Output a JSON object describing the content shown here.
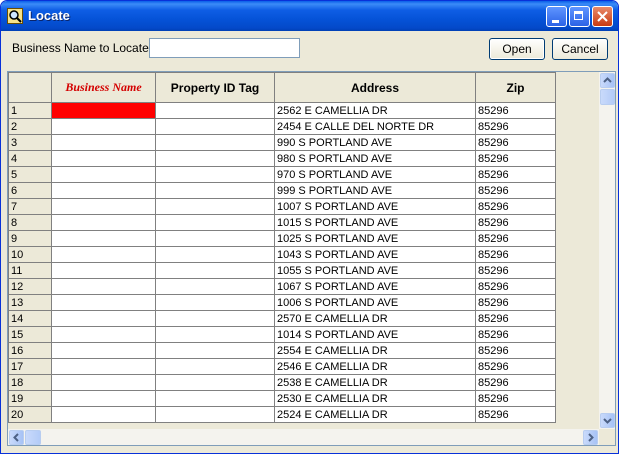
{
  "window": {
    "title": "Locate"
  },
  "form": {
    "label": "Business Name to Locate:",
    "search_value": "",
    "open_label": "Open",
    "cancel_label": "Cancel"
  },
  "grid": {
    "headers": [
      "",
      "Business Name",
      "Property ID Tag",
      "Address",
      "Zip"
    ],
    "rows": [
      {
        "num": "1",
        "business": "",
        "tag": "",
        "address": "2562 E CAMELLIA DR",
        "zip": "85296"
      },
      {
        "num": "2",
        "business": "",
        "tag": "",
        "address": "2454 E CALLE DEL NORTE DR",
        "zip": "85296"
      },
      {
        "num": "3",
        "business": "",
        "tag": "",
        "address": "990 S PORTLAND AVE",
        "zip": "85296"
      },
      {
        "num": "4",
        "business": "",
        "tag": "",
        "address": "980 S PORTLAND AVE",
        "zip": "85296"
      },
      {
        "num": "5",
        "business": "",
        "tag": "",
        "address": "970 S PORTLAND AVE",
        "zip": "85296"
      },
      {
        "num": "6",
        "business": "",
        "tag": "",
        "address": "999 S PORTLAND AVE",
        "zip": "85296"
      },
      {
        "num": "7",
        "business": "",
        "tag": "",
        "address": "1007 S PORTLAND AVE",
        "zip": "85296"
      },
      {
        "num": "8",
        "business": "",
        "tag": "",
        "address": "1015 S PORTLAND AVE",
        "zip": "85296"
      },
      {
        "num": "9",
        "business": "",
        "tag": "",
        "address": "1025 S PORTLAND AVE",
        "zip": "85296"
      },
      {
        "num": "10",
        "business": "",
        "tag": "",
        "address": "1043 S PORTLAND AVE",
        "zip": "85296"
      },
      {
        "num": "11",
        "business": "",
        "tag": "",
        "address": "1055 S PORTLAND AVE",
        "zip": "85296"
      },
      {
        "num": "12",
        "business": "",
        "tag": "",
        "address": "1067 S PORTLAND AVE",
        "zip": "85296"
      },
      {
        "num": "13",
        "business": "",
        "tag": "",
        "address": "1006 S PORTLAND AVE",
        "zip": "85296"
      },
      {
        "num": "14",
        "business": "",
        "tag": "",
        "address": "2570 E CAMELLIA DR",
        "zip": "85296"
      },
      {
        "num": "15",
        "business": "",
        "tag": "",
        "address": "1014 S PORTLAND AVE",
        "zip": "85296"
      },
      {
        "num": "16",
        "business": "",
        "tag": "",
        "address": "2554 E CAMELLIA DR",
        "zip": "85296"
      },
      {
        "num": "17",
        "business": "",
        "tag": "",
        "address": "2546 E CAMELLIA DR",
        "zip": "85296"
      },
      {
        "num": "18",
        "business": "",
        "tag": "",
        "address": "2538 E CAMELLIA DR",
        "zip": "85296"
      },
      {
        "num": "19",
        "business": "",
        "tag": "",
        "address": "2530 E CAMELLIA DR",
        "zip": "85296"
      },
      {
        "num": "20",
        "business": "",
        "tag": "",
        "address": "2524 E CAMELLIA DR",
        "zip": "85296"
      }
    ]
  },
  "icons": {
    "app": "magnifier-icon",
    "minimize": "minimize-icon",
    "maximize": "maximize-icon",
    "close": "close-icon",
    "scroll_up": "arrow-up-icon",
    "scroll_down": "arrow-down-icon",
    "scroll_left": "arrow-left-icon",
    "scroll_right": "arrow-right-icon"
  },
  "colors": {
    "titlebar": "#0553d8",
    "selected_cell": "#ff0000",
    "business_header": "#d40000"
  }
}
